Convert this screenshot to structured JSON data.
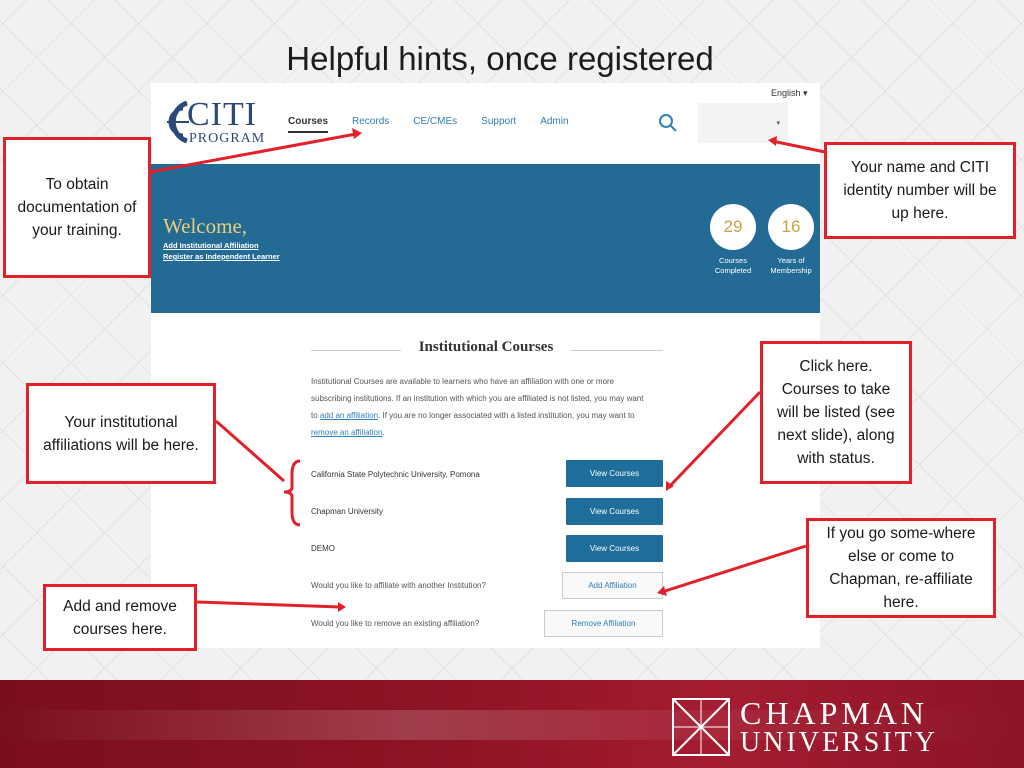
{
  "slide": {
    "title": "Helpful hints, once registered"
  },
  "citi": {
    "language": "English ▾",
    "logo_main": "CITI",
    "logo_sub": "PROGRAM",
    "nav": [
      {
        "label": "Courses"
      },
      {
        "label": "Records"
      },
      {
        "label": "CE/CMEs"
      },
      {
        "label": "Support"
      },
      {
        "label": "Admin"
      }
    ],
    "user_caret": "▾",
    "welcome": "Welcome,",
    "welcome_links": [
      "Add Institutional Affiliation",
      "Register as Independent Learner"
    ],
    "stats": [
      {
        "value": "29",
        "label_1": "Courses",
        "label_2": "Completed"
      },
      {
        "value": "16",
        "label_1": "Years of",
        "label_2": "Membership"
      }
    ],
    "section_title": "Institutional Courses",
    "desc_1": "Institutional Courses are available to learners who have an affiliation with one or more subscribing institutions. If an institution with which you are affiliated is not listed, you may want to ",
    "desc_link_1": "add an affiliation",
    "desc_2": ". If you are no longer associated with a listed institution, you may want to ",
    "desc_link_2": "remove an affiliation",
    "desc_3": ".",
    "institutions": [
      {
        "name": "California State Polytechnic University, Pomona",
        "button": "View Courses"
      },
      {
        "name": "Chapman University",
        "button": "View Courses"
      },
      {
        "name": "DEMO",
        "button": "View Courses"
      }
    ],
    "affiliate_question": "Would you like to affiliate with another Institution?",
    "affiliate_button": "Add Affiliation",
    "remove_question": "Would you like to remove an existing affiliation?",
    "remove_button": "Remove Affiliation"
  },
  "callouts": {
    "documentation": "To obtain documentation of your training.",
    "identity": "Your name and CITI identity number will be up here.",
    "affiliations": "Your institutional affiliations will be here.",
    "click_here": "Click here. Courses to take will be listed (see next slide), along with status.",
    "reaffiliate": "If you go some-where else or come to Chapman, re-affiliate here.",
    "add_remove": "Add and remove courses here."
  },
  "footer": {
    "line_1": "CHAPMAN",
    "line_2": "UNIVERSITY"
  },
  "colors": {
    "accent_red": "#e2202a",
    "citi_blue": "#236a94",
    "chapman_red": "#8e1424"
  }
}
